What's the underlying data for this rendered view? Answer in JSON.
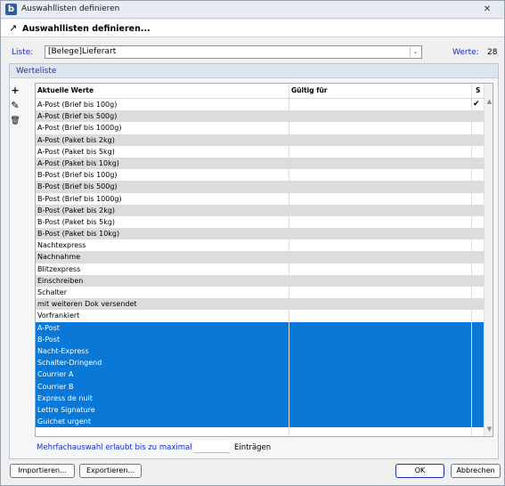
{
  "window": {
    "title": "Auswahllisten definieren",
    "app_icon": "b",
    "close_glyph": "✕"
  },
  "header": {
    "icon": "arrow-icon",
    "title": "Auswahllisten definieren..."
  },
  "form": {
    "liste_label": "Liste:",
    "liste_value": "[Belege]Lieferart",
    "werte_label": "Werte:",
    "werte_count": "28"
  },
  "group": {
    "title": "Werteliste"
  },
  "toolbar": {
    "add": "+",
    "edit": "✎",
    "delete": "🗑"
  },
  "table": {
    "columns": [
      "Aktuelle Werte",
      "Gültig für",
      "S"
    ],
    "rows": [
      {
        "value": "A-Post (Brief bis 100g)",
        "check": "✔"
      },
      {
        "value": "A-Post (Brief bis 500g)"
      },
      {
        "value": "A-Post (Brief bis 1000g)"
      },
      {
        "value": "A-Post (Paket bis 2kg)"
      },
      {
        "value": "A-Post (Paket bis 5kg)"
      },
      {
        "value": "A-Post (Paket bis 10kg)"
      },
      {
        "value": "B-Post (Brief bis 100g)"
      },
      {
        "value": "B-Post (Brief bis 500g)"
      },
      {
        "value": "B-Post (Brief bis 1000g)"
      },
      {
        "value": "B-Post (Paket bis 2kg)"
      },
      {
        "value": "B-Post (Paket bis 5kg)"
      },
      {
        "value": "B-Post (Paket bis 10kg)"
      },
      {
        "value": "Nachtexpress"
      },
      {
        "value": "Nachnahme"
      },
      {
        "value": "Blitzexpress"
      },
      {
        "value": "Einschreiben"
      },
      {
        "value": "Schalter"
      },
      {
        "value": "mit weiteren Dok versendet"
      },
      {
        "value": "Vorfrankiert"
      },
      {
        "value": "A-Post",
        "selected": true
      },
      {
        "value": "B-Post",
        "selected": true
      },
      {
        "value": "Nacht-Express",
        "selected": true
      },
      {
        "value": "Schalter-Dringend",
        "selected": true
      },
      {
        "value": "Courrier A",
        "selected": true
      },
      {
        "value": "Courrier B",
        "selected": true
      },
      {
        "value": "Express de nuit",
        "selected": true
      },
      {
        "value": "Lettre Signature",
        "selected": true
      },
      {
        "value": "Guichet urgent",
        "selected": true
      }
    ]
  },
  "footer": {
    "multi_label": "Mehrfachauswahl erlaubt bis zu maximal",
    "multi_value": "",
    "multi_suffix": "Einträgen",
    "import_label": "Importieren...",
    "export_label": "Exportieren...",
    "ok_label": "OK",
    "cancel_label": "Abbrechen"
  },
  "colors": {
    "selection": "#0a78d7",
    "label_blue": "#1b2cc4",
    "alt_row": "#dcdcdc"
  }
}
